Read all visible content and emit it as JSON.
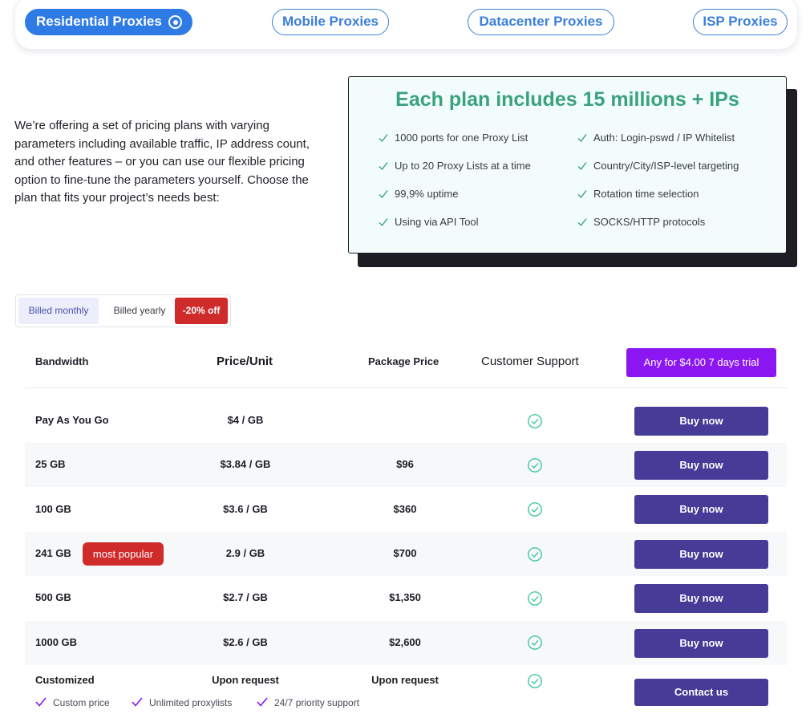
{
  "tabs": [
    {
      "label": "Residential Proxies",
      "active": true
    },
    {
      "label": "Mobile Proxies",
      "active": false
    },
    {
      "label": "Datacenter Proxies",
      "active": false
    },
    {
      "label": "ISP Proxies",
      "active": false
    }
  ],
  "intro": "We’re offering a set of pricing plans with varying parameters including available traffic, IP address count, and other features – or you can use our flexible pricing option to fine-tune the parameters yourself. Choose the plan that fits your project’s needs best:",
  "features_card": {
    "title": "Each plan includes 15 millions + IPs",
    "left": [
      "1000 ports for one Proxy List",
      "Up to 20 Proxy Lists at a time",
      "99,9% uptime",
      "Using via API Tool"
    ],
    "right": [
      "Auth: Login-pswd / IP Whitelist",
      "Country/City/ISP-level targeting",
      "Rotation time selection",
      "SOCKS/HTTP protocols"
    ]
  },
  "billing": {
    "monthly": "Billed monthly",
    "yearly": "Billed yearly",
    "discount": "-20% off"
  },
  "table": {
    "headers": {
      "bandwidth": "Bandwidth",
      "price_unit": "Price/Unit",
      "package_price": "Package Price",
      "support": "Customer Support"
    },
    "trial_button": "Any for $4.00 7 days trial",
    "buy_label": "Buy now",
    "contact_label": "Contact us",
    "popular_badge": "most popular",
    "rows": [
      {
        "bandwidth": "Pay As You Go",
        "unit": "$4 / GB",
        "package": ""
      },
      {
        "bandwidth": "25 GB",
        "unit": "$3.84 / GB",
        "package": "$96"
      },
      {
        "bandwidth": "100 GB",
        "unit": "$3.6 / GB",
        "package": "$360"
      },
      {
        "bandwidth": "241 GB",
        "unit": "2.9 / GB",
        "package": "$700"
      },
      {
        "bandwidth": "500 GB",
        "unit": "$2.7 / GB",
        "package": "$1,350"
      },
      {
        "bandwidth": "1000 GB",
        "unit": "$2.6 / GB",
        "package": "$2,600"
      }
    ],
    "custom": {
      "bandwidth": "Customized",
      "unit": "Upon request",
      "package": "Upon request",
      "features": [
        "Custom price",
        "Unlimited proxylists",
        "24/7 priority support"
      ]
    }
  },
  "colors": {
    "tab_blue": "#2f7be6",
    "title_green": "#3aa17f",
    "buy_purple": "#463b97",
    "trial_violet": "#8b16f2",
    "badge_red": "#cf2b2b"
  }
}
